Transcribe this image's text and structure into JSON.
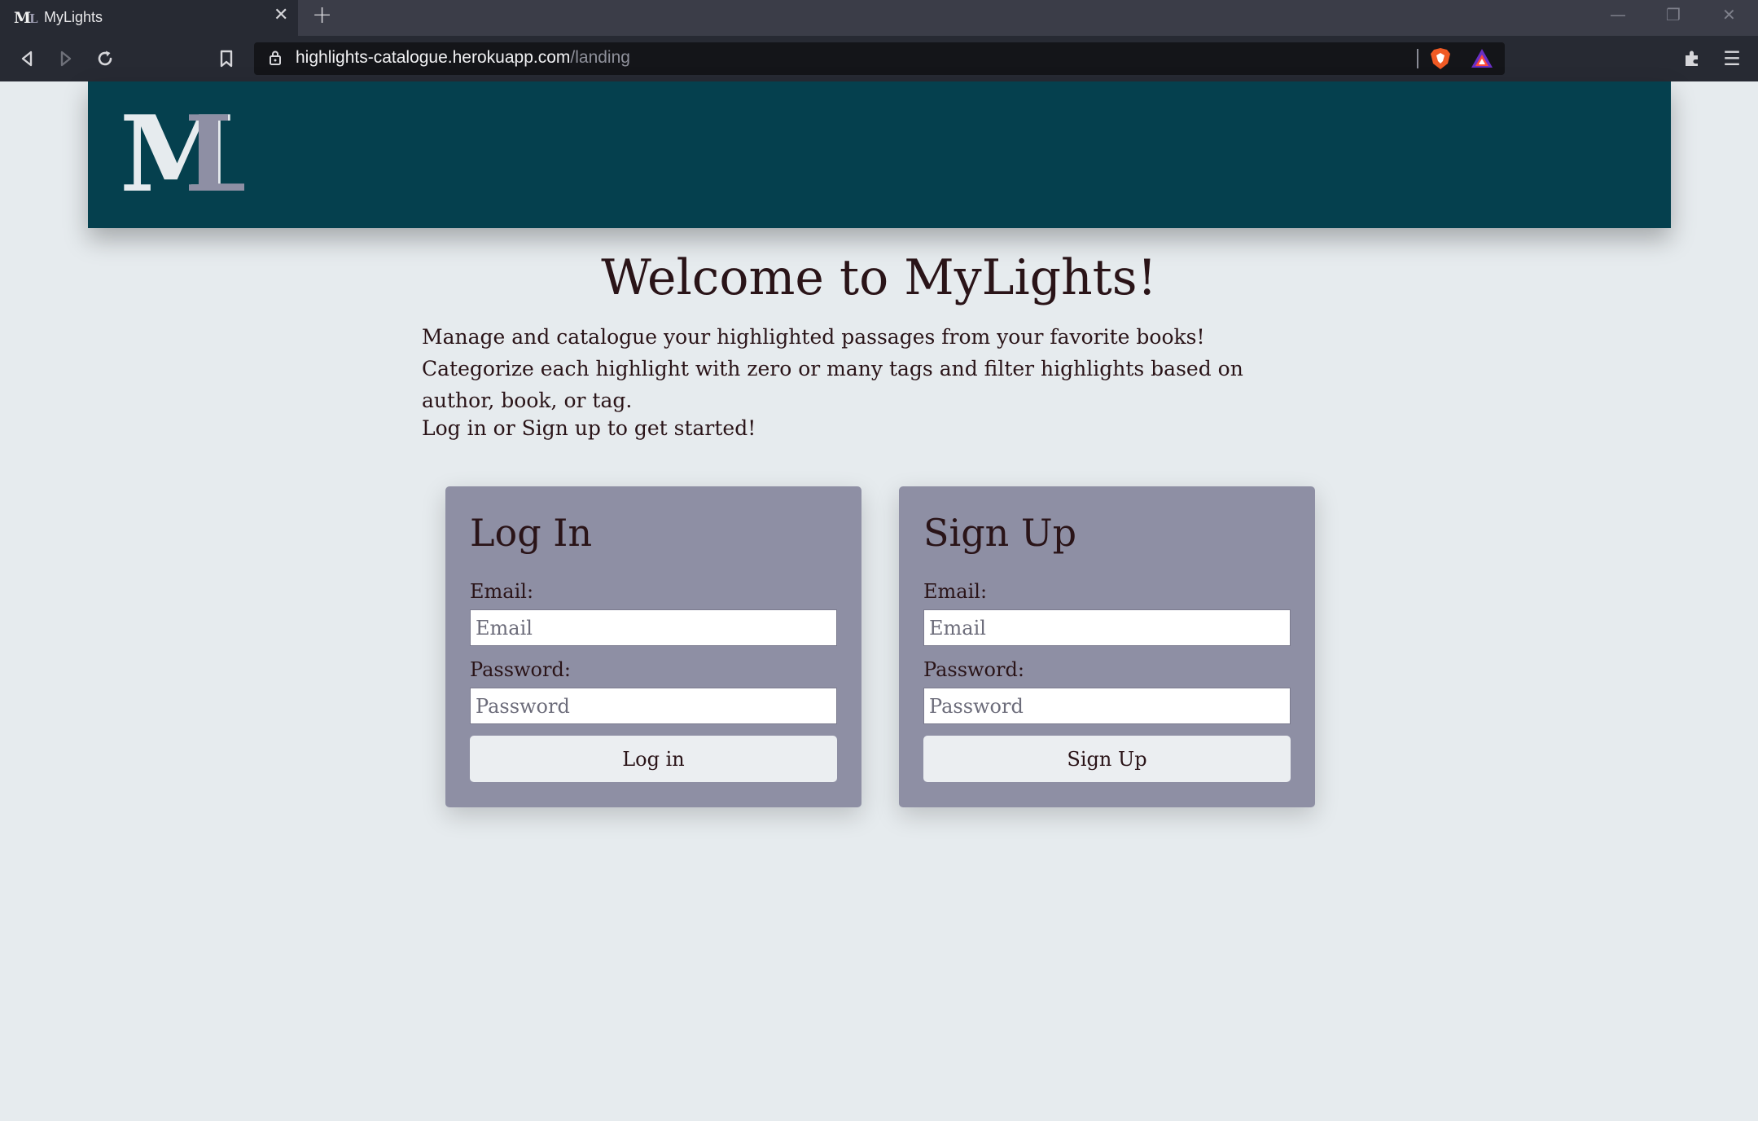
{
  "browser": {
    "tab_title": "MyLights",
    "tab_favicon_m": "M",
    "tab_favicon_l": "L",
    "close_glyph": "✕",
    "new_tab_glyph": "+",
    "url_host": "highlights-catalogue.herokuapp.com",
    "url_path": "/landing",
    "minimize_glyph": "—",
    "restore_glyph": "❐",
    "window_close_glyph": "✕",
    "menu_glyph": "☰"
  },
  "logo": {
    "letter_m": "M",
    "letter_l": "L",
    "color_m": "#e6ebee",
    "color_l": "#8e8fa4"
  },
  "colors": {
    "header": "#05404e",
    "card": "#8e8fa4",
    "background": "#e6ebee"
  },
  "page": {
    "welcome_title": "Welcome to MyLights!",
    "intro": "Manage and catalogue your highlighted passages from your favorite books! Categorize each highlight with zero or many tags and filter highlights based on author, book, or tag.",
    "cta": "Log in or Sign up to get started!"
  },
  "login": {
    "title": "Log In",
    "email_label": "Email:",
    "email_placeholder": "Email",
    "password_label": "Password:",
    "password_placeholder": "Password",
    "button": "Log in"
  },
  "signup": {
    "title": "Sign Up",
    "email_label": "Email:",
    "email_placeholder": "Email",
    "password_label": "Password:",
    "password_placeholder": "Password",
    "button": "Sign Up"
  }
}
